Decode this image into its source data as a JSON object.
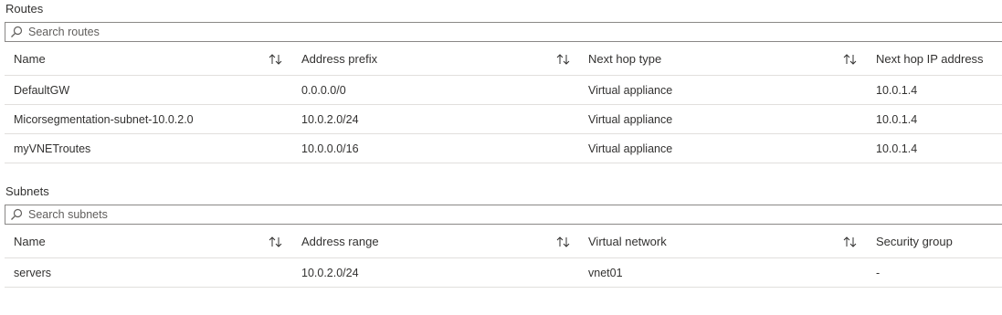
{
  "routes": {
    "title": "Routes",
    "search_placeholder": "Search routes",
    "columns": [
      "Name",
      "Address prefix",
      "Next hop type",
      "Next hop IP address"
    ],
    "rows": [
      [
        "DefaultGW",
        "0.0.0.0/0",
        "Virtual appliance",
        "10.0.1.4"
      ],
      [
        "Micorsegmentation-subnet-10.0.2.0",
        "10.0.2.0/24",
        "Virtual appliance",
        "10.0.1.4"
      ],
      [
        "myVNETroutes",
        "10.0.0.0/16",
        "Virtual appliance",
        "10.0.1.4"
      ]
    ]
  },
  "subnets": {
    "title": "Subnets",
    "search_placeholder": "Search subnets",
    "columns": [
      "Name",
      "Address range",
      "Virtual network",
      "Security group"
    ],
    "rows": [
      [
        "servers",
        "10.0.2.0/24",
        "vnet01",
        "-"
      ]
    ]
  },
  "icons": {
    "search": "search-icon",
    "sort": "sort-arrows-icon"
  },
  "colors": {
    "text": "#323130",
    "border": "#8a8886",
    "row_divider": "#e1dfdd"
  }
}
